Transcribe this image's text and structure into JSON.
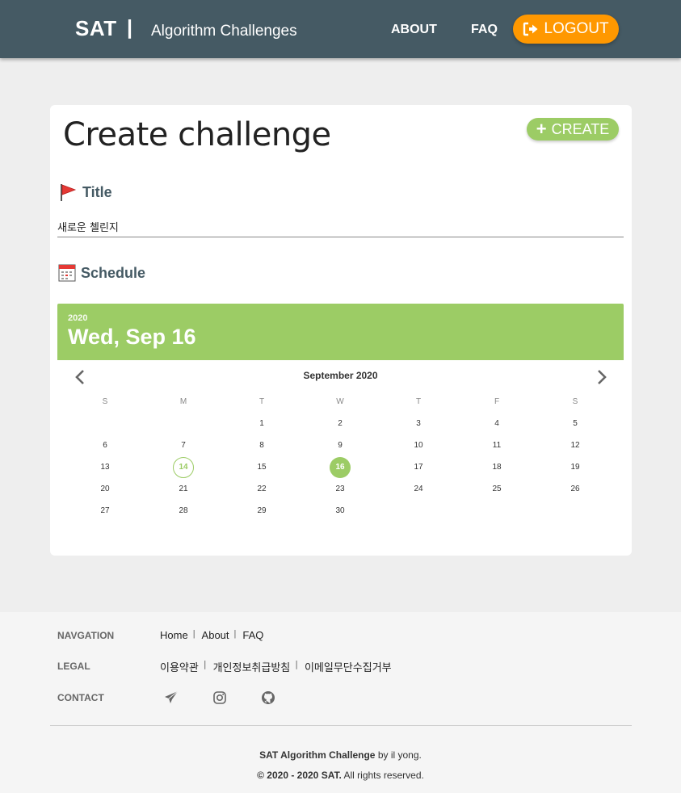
{
  "header": {
    "brand": "SAT",
    "separator": "|",
    "subtitle": "Algorithm Challenges",
    "nav": {
      "about": "ABOUT",
      "faq": "FAQ",
      "logout": "LOGOUT"
    }
  },
  "card": {
    "heading": "Create challenge",
    "create_label": "CREATE",
    "title_section": "Title",
    "title_value": "새로운 첼린지",
    "schedule_section": "Schedule"
  },
  "datepicker": {
    "year": "2020",
    "selected_date_label": "Wed, Sep 16",
    "month_label": "September 2020",
    "weekdays": [
      "S",
      "M",
      "T",
      "W",
      "T",
      "F",
      "S"
    ],
    "days": [
      "1",
      "2",
      "3",
      "4",
      "5",
      "6",
      "7",
      "8",
      "9",
      "10",
      "11",
      "12",
      "13",
      "14",
      "15",
      "16",
      "17",
      "18",
      "19",
      "20",
      "21",
      "22",
      "23",
      "24",
      "25",
      "26",
      "27",
      "28",
      "29",
      "30"
    ],
    "today": "14",
    "selected": "16"
  },
  "footer": {
    "navigation_label": "NAVGATION",
    "nav_links": [
      "Home",
      "About",
      "FAQ"
    ],
    "legal_label": "LEGAL",
    "legal_links": [
      "이용약관",
      "개인정보취급방침",
      "이메일무단수집거부"
    ],
    "contact_label": "CONTACT",
    "credit_name": "SAT Algorithm Challenge",
    "credit_by": " by il yong.",
    "copyright_bold": "© 2020 - 2020 SAT.",
    "copyright_rest": " All rights reserved."
  },
  "colors": {
    "header": "#455a64",
    "accent_orange": "#ff9800",
    "accent_green": "#9ccc65"
  }
}
